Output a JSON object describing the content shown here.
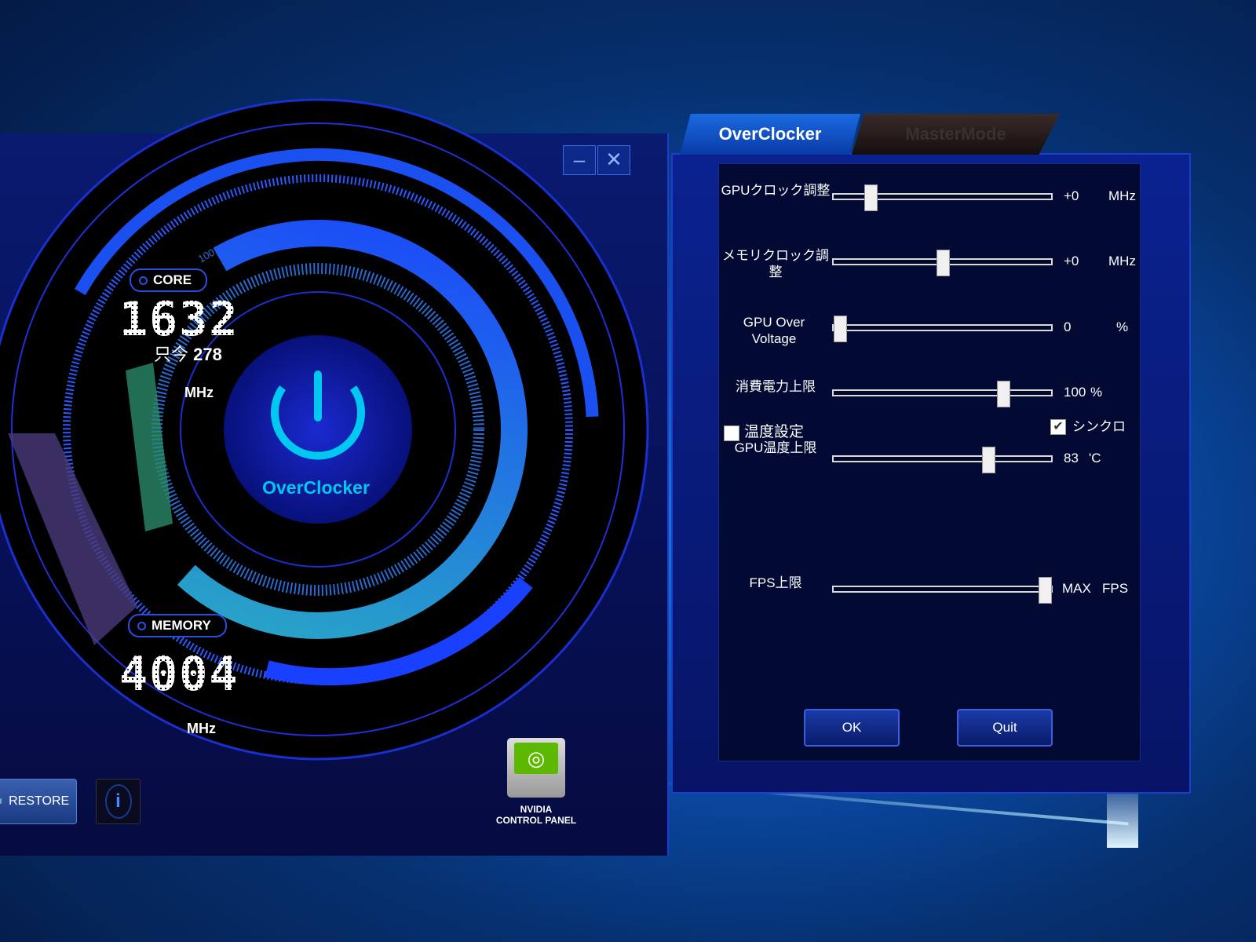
{
  "window": {
    "minimize_icon": "minimize-icon",
    "close_icon": "close-icon"
  },
  "dial": {
    "core": {
      "label": "CORE",
      "value": "1632",
      "sub_label": "只今",
      "sub_value": "278",
      "unit": "MHz",
      "scale_mark": "100"
    },
    "memory": {
      "label": "MEMORY",
      "value": "4004",
      "unit": "MHz"
    },
    "power_button_label": "OverClocker",
    "accent": "#00c8f0"
  },
  "bottom": {
    "restore_label": "RESTORE",
    "info_icon": "info-icon",
    "nvidia_label_1": "NVIDIA",
    "nvidia_label_2": "CONTROL PANEL"
  },
  "tabs": [
    {
      "label": "OverClocker",
      "active": true
    },
    {
      "label": "MasterMode",
      "active": false
    }
  ],
  "settings": [
    {
      "label": "GPUクロック調整",
      "value": "+0",
      "unit": "MHz",
      "position": 0.17
    },
    {
      "label": "メモリクロック調整",
      "value": "+0",
      "unit": "MHz",
      "position": 0.5
    },
    {
      "label": "GPU Over Voltage",
      "value": "0",
      "unit": "%",
      "position": 0.03
    },
    {
      "label": "消費電力上限",
      "value": "100",
      "unit": "%",
      "position": 0.78
    },
    {
      "label": "GPU温度上限",
      "value": "83",
      "unit": "'C",
      "position": 0.71
    },
    {
      "label": "FPS上限",
      "value": "MAX",
      "unit": "FPS",
      "position": 0.97
    }
  ],
  "temp_setting": {
    "label": "温度設定",
    "checked": false
  },
  "sync": {
    "label": "シンクロ",
    "checked": true
  },
  "buttons": {
    "ok": "OK",
    "quit": "Quit"
  }
}
